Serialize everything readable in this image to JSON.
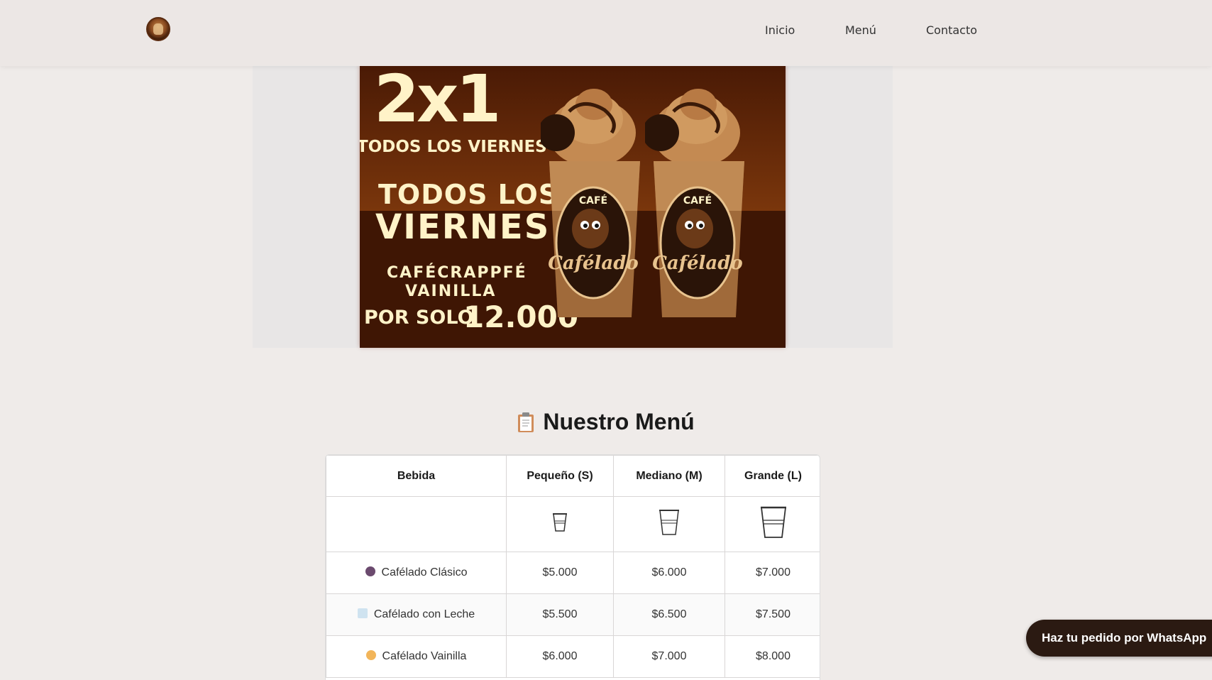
{
  "header": {
    "logo_alt": "Cafélado",
    "nav": [
      {
        "label": "Inicio"
      },
      {
        "label": "Menú"
      },
      {
        "label": "Contacto"
      }
    ]
  },
  "banner": {
    "big": "2x1",
    "small": "TODOS LOS VIERNES",
    "line1": "TODOS LOS",
    "line2": "VIERNES",
    "product1": "CAFÉCRAPPFÉ",
    "product2": "VAINILLA",
    "price_prefix": "POR SOLO",
    "price": "12.000",
    "cup_brand_top": "CAFÉ",
    "cup_brand": "Cafélado"
  },
  "menu": {
    "title": "Nuestro Menú",
    "title_icon": "clipboard-icon",
    "headers": [
      "Bebida",
      "Pequeño (S)",
      "Mediano (M)",
      "Grande (L)"
    ],
    "size_icons": [
      "cup-small-icon",
      "cup-medium-icon",
      "cup-large-icon"
    ],
    "rows": [
      {
        "icon": "coffee-bean-icon",
        "icon_color": "#6b4a6e",
        "name": "Cafélado Clásico",
        "s": "$5.000",
        "m": "$6.000",
        "l": "$7.000"
      },
      {
        "icon": "glass-milk-icon",
        "icon_color": "#cfe3f0",
        "name": "Cafélado con Leche",
        "s": "$5.500",
        "m": "$6.500",
        "l": "$7.500"
      },
      {
        "icon": "ice-cream-icon",
        "icon_color": "#f2b55a",
        "name": "Cafélado Vainilla",
        "s": "$6.000",
        "m": "$7.000",
        "l": "$8.000"
      }
    ]
  },
  "whatsapp": {
    "label": "Haz tu pedido por WhatsApp"
  }
}
